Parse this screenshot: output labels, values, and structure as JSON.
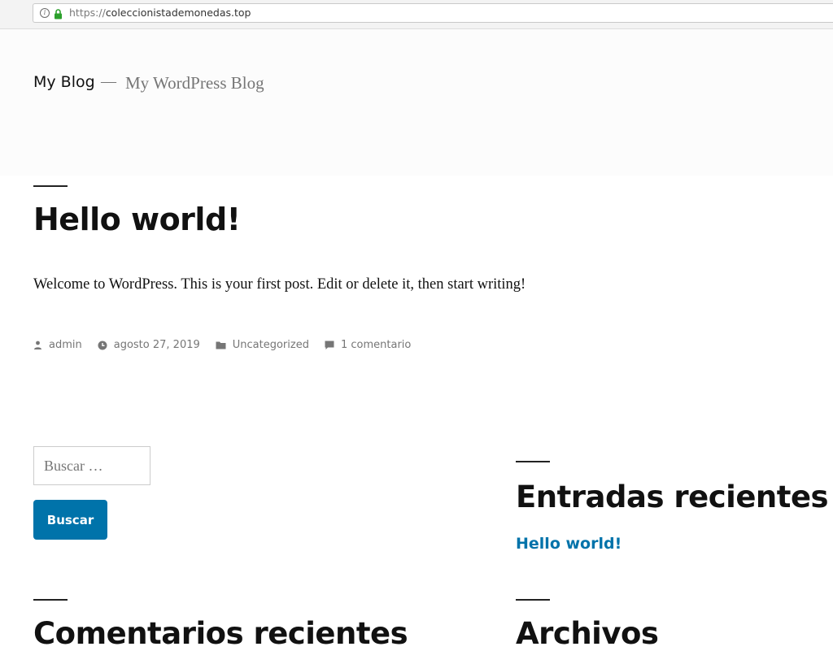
{
  "browser": {
    "url_protocol": "https://",
    "url_host": "coleccionistademonedas.top",
    "icons": [
      "info-icon",
      "lock-icon"
    ],
    "lock_color": "#2ca02c"
  },
  "header": {
    "site_title": "My Blog",
    "separator": "—",
    "site_description": "My WordPress Blog"
  },
  "post": {
    "title": "Hello world!",
    "content": "Welcome to WordPress. This is your first post. Edit or delete it, then start writing!",
    "meta": {
      "author": "admin",
      "date": "agosto 27, 2019",
      "category": "Uncategorized",
      "comments": "1 comentario",
      "icons": [
        "person-icon",
        "clock-icon",
        "folder-icon",
        "comment-icon"
      ]
    }
  },
  "search": {
    "placeholder": "Buscar …",
    "button_label": "Buscar"
  },
  "widgets": {
    "recent_posts": {
      "title": "Entradas recientes",
      "items": [
        "Hello world!"
      ]
    },
    "recent_comments": {
      "title": "Comentarios recientes"
    },
    "archives": {
      "title": "Archivos"
    }
  },
  "colors": {
    "accent": "#0073aa",
    "text": "#111111",
    "muted": "#767676"
  }
}
